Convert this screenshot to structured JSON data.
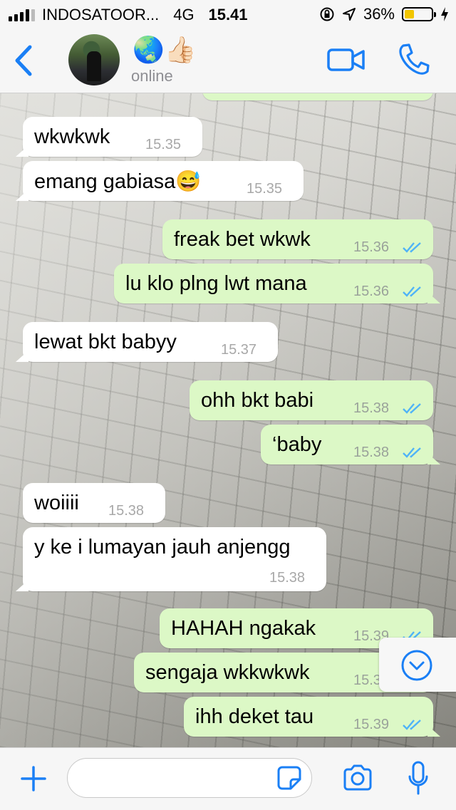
{
  "status_bar": {
    "carrier": "INDOSATOOR...",
    "network": "4G",
    "time": "15.41",
    "battery": "36%",
    "battery_level": 0.36
  },
  "header": {
    "contact_name_emoji": "🌏👍🏻",
    "status": "online",
    "accent_color": "#1a7ff5"
  },
  "messages": [
    {
      "dir": "in",
      "text": "wkwkwk",
      "time": "15.35"
    },
    {
      "dir": "in",
      "text": "emang gabiasa😅",
      "time": "15.35"
    },
    {
      "dir": "out",
      "text": "freak bet wkwk",
      "time": "15.36",
      "read": true
    },
    {
      "dir": "out",
      "text": "lu klo plng lwt mana",
      "time": "15.36",
      "read": true
    },
    {
      "dir": "in",
      "text": "lewat bkt babyy",
      "time": "15.37"
    },
    {
      "dir": "out",
      "text": "ohh bkt babi",
      "time": "15.38",
      "read": true
    },
    {
      "dir": "out",
      "text": "‘baby",
      "time": "15.38",
      "read": true
    },
    {
      "dir": "in",
      "text": "woiiii",
      "time": "15.38"
    },
    {
      "dir": "in",
      "text": "y ke i lumayan jauh anjengg",
      "time": "15.38"
    },
    {
      "dir": "out",
      "text": "HAHAH ngakak",
      "time": "15.39",
      "read": true
    },
    {
      "dir": "out",
      "text": "sengaja wkkwkwk",
      "time": "15.39",
      "read": true
    },
    {
      "dir": "out",
      "text": "ihh deket tau",
      "time": "15.39",
      "read": true
    }
  ],
  "input": {
    "placeholder": ""
  },
  "colors": {
    "incoming_bubble": "#ffffff",
    "outgoing_bubble": "#dcf8c6",
    "read_ticks": "#4fb3f7"
  }
}
